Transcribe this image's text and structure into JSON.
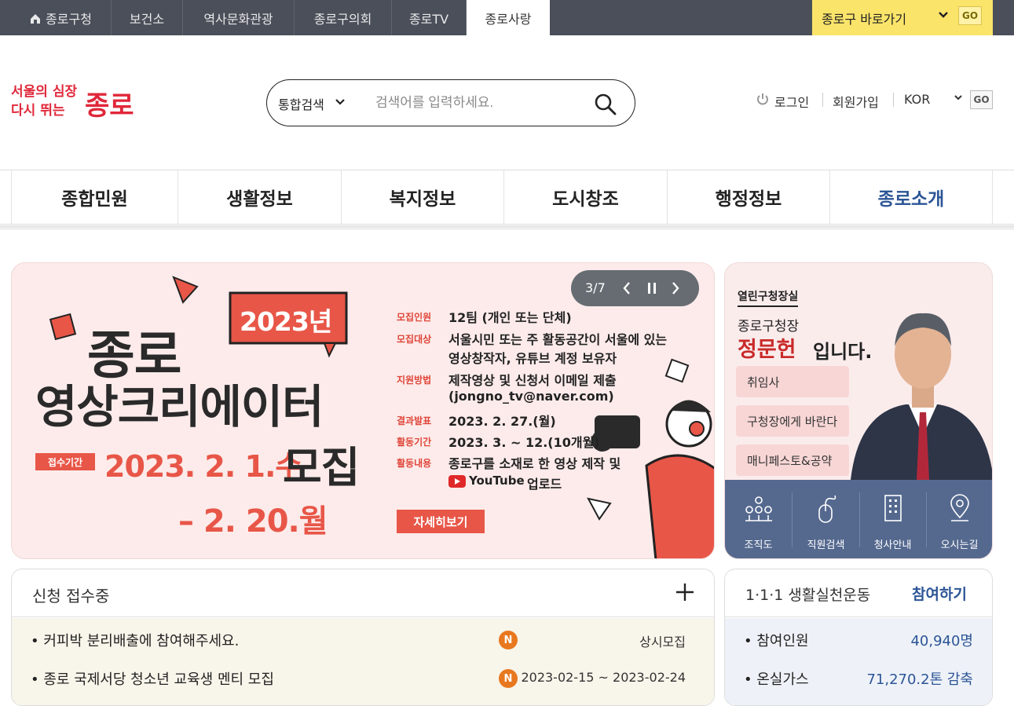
{
  "top_bar": {
    "tabs": [
      {
        "label": "종로구청"
      },
      {
        "label": "보건소"
      },
      {
        "label": "역사문화관광"
      },
      {
        "label": "종로구의회"
      },
      {
        "label": "종로TV"
      },
      {
        "label": "종로사랑"
      }
    ],
    "shortcut_label": "종로구 바로가기",
    "go_label": "GO"
  },
  "header": {
    "logo_tagline_1": "서울의 심장",
    "logo_tagline_2": "다시 뛰는",
    "logo_name": "종로",
    "search_scope": "통합검색",
    "search_placeholder": "검색어를 입력하세요.",
    "login_label": "로그인",
    "signup_label": "회원가입",
    "language": "KOR",
    "language_go": "GO"
  },
  "main_nav": [
    {
      "label": "종합민원"
    },
    {
      "label": "생활정보"
    },
    {
      "label": "복지정보"
    },
    {
      "label": "도시창조"
    },
    {
      "label": "행정정보"
    },
    {
      "label": "종로소개"
    }
  ],
  "banner": {
    "counter": "3/7",
    "year_badge": "2023년",
    "title_line1": "종로",
    "title_line2": "영상크리에이터",
    "period_label": "접수기간",
    "period_start": "2023. 2. 1.수",
    "recruit_word": "모집",
    "period_end": "– 2. 20.월",
    "info": [
      {
        "label": "모집인원",
        "value": "12팀 (개인 또는 단체)"
      },
      {
        "label": "모집대상",
        "value": "서울시민 또는 주 활동공간이 서울에 있는"
      },
      {
        "label": "",
        "value": "영상창작자, 유튜브 계정 보유자"
      },
      {
        "label": "지원방법",
        "value": "제작영상 및 신청서 이메일 제출"
      },
      {
        "label": "",
        "value": "(jongno_tv@naver.com)"
      },
      {
        "label": "결과발표",
        "value": "2023. 2. 27.(월)"
      },
      {
        "label": "활동기간",
        "value": "2023. 3. ~ 12.(10개월)"
      },
      {
        "label": "활동내용",
        "value": "종로구를 소재로 한 영상 제작 및"
      },
      {
        "label": "",
        "value": "업로드"
      }
    ],
    "youtube_word": "YouTube",
    "detail_button": "자세히보기"
  },
  "mayor_panel": {
    "kicker": "열린구청장실",
    "position": "종로구청장",
    "name": "정문헌",
    "name_suffix": "입니다.",
    "buttons": [
      {
        "label": "취임사"
      },
      {
        "label": "구청장에게 바란다"
      },
      {
        "label": "매니페스토&공약"
      }
    ],
    "quick_links": [
      {
        "label": "조직도",
        "icon": "org-chart-icon"
      },
      {
        "label": "직원검색",
        "icon": "mouse-icon"
      },
      {
        "label": "청사안내",
        "icon": "building-icon"
      },
      {
        "label": "오시는길",
        "icon": "location-pin-icon"
      }
    ]
  },
  "applications": {
    "title": "신청 접수중",
    "rows": [
      {
        "title": "• 커피박 분리배출에 참여해주세요.",
        "badge": "N",
        "period": "상시모집"
      },
      {
        "title": "• 종로 국제서당 청소년 교육생 멘티 모집",
        "badge": "N",
        "period": "2023-02-15 ~ 2023-02-24"
      }
    ]
  },
  "campaign": {
    "title": "1·1·1 생활실천운동",
    "join_label": "참여하기",
    "stats": [
      {
        "label": "•  참여인원",
        "value": "40,940명"
      },
      {
        "label": "•  온실가스",
        "value": "71,270.2톤 감축"
      }
    ]
  },
  "colors": {
    "topbar_bg": "#4a4f5a",
    "shortcut_bg": "#fbe46a",
    "brand_red": "#e0283a",
    "nav_current": "#2c5596",
    "quick_bar": "#55698f",
    "badge_orange": "#e8781f"
  }
}
